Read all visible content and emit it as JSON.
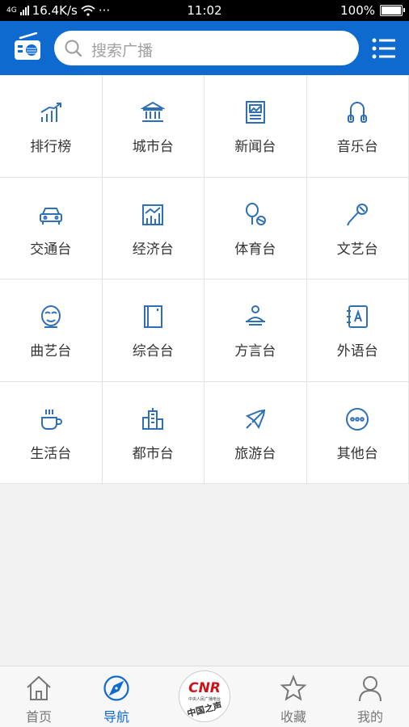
{
  "status_bar": {
    "network": "4G",
    "speed": "16.4K/s",
    "more": "···",
    "time": "11:02",
    "battery": "100%"
  },
  "search": {
    "placeholder": "搜索广播"
  },
  "colors": {
    "brand": "#0f6ad0",
    "icon": "#2f6fb6"
  },
  "categories": [
    {
      "label": "排行榜",
      "icon": "ranking-chart-icon"
    },
    {
      "label": "城市台",
      "icon": "city-building-icon"
    },
    {
      "label": "新闻台",
      "icon": "newspaper-icon"
    },
    {
      "label": "音乐台",
      "icon": "headphones-icon"
    },
    {
      "label": "交通台",
      "icon": "car-icon"
    },
    {
      "label": "经济台",
      "icon": "economy-chart-icon"
    },
    {
      "label": "体育台",
      "icon": "racket-ball-icon"
    },
    {
      "label": "文艺台",
      "icon": "microphone-icon"
    },
    {
      "label": "曲艺台",
      "icon": "opera-mask-icon"
    },
    {
      "label": "综合台",
      "icon": "notebook-icon"
    },
    {
      "label": "方言台",
      "icon": "person-podium-icon"
    },
    {
      "label": "外语台",
      "icon": "language-book-icon"
    },
    {
      "label": "生活台",
      "icon": "coffee-cup-icon"
    },
    {
      "label": "都市台",
      "icon": "city-skyline-icon"
    },
    {
      "label": "旅游台",
      "icon": "airplane-icon"
    },
    {
      "label": "其他台",
      "icon": "more-dots-icon"
    }
  ],
  "tabbar": {
    "tabs": [
      {
        "label": "首页",
        "icon": "home-icon"
      },
      {
        "label": "导航",
        "icon": "compass-icon"
      },
      {
        "label": "收藏",
        "icon": "star-icon"
      },
      {
        "label": "我的",
        "icon": "user-icon"
      }
    ],
    "center_logo": {
      "mark": "CNR",
      "subtitle": "中央人民广播电台",
      "name": "中国之声"
    }
  }
}
